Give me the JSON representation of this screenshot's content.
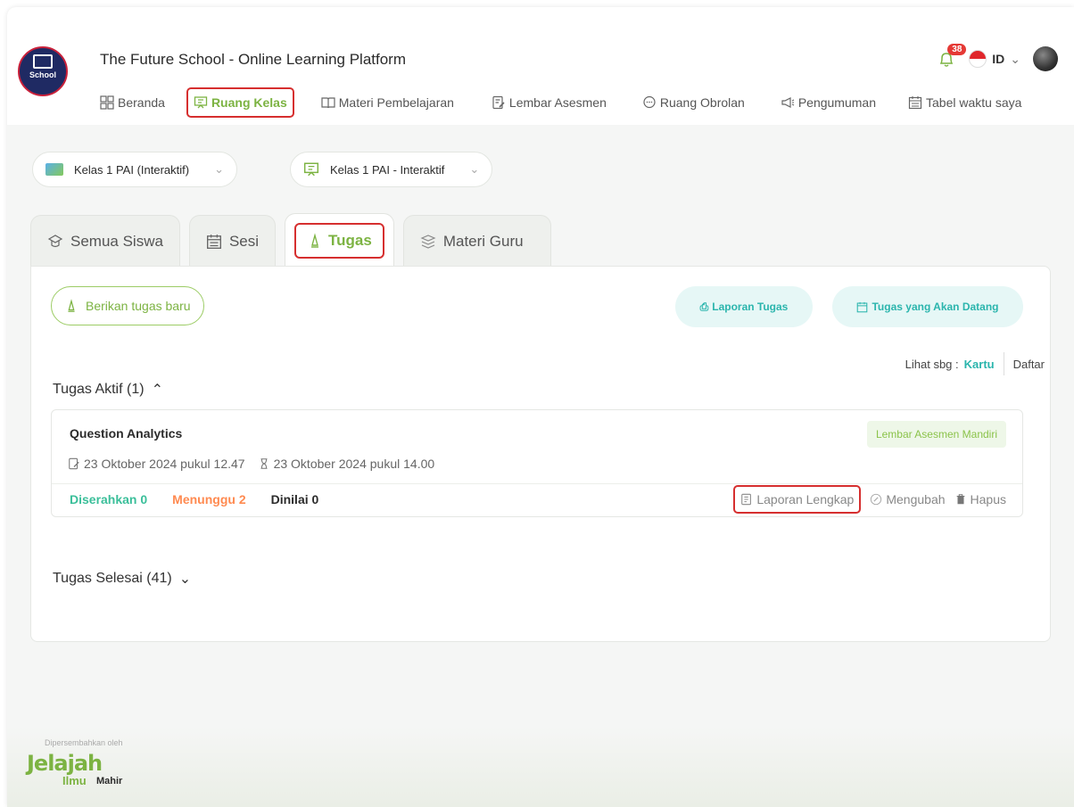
{
  "app": {
    "title": "The Future School - Online Learning Platform",
    "logo_text": "School",
    "notification_count": "38",
    "language": "ID"
  },
  "nav": {
    "items": [
      {
        "label": "Beranda",
        "icon": "grid-icon"
      },
      {
        "label": "Ruang Kelas",
        "icon": "classroom-icon",
        "active": true
      },
      {
        "label": "Materi Pembelajaran",
        "icon": "book-icon"
      },
      {
        "label": "Lembar Asesmen",
        "icon": "assessment-icon"
      },
      {
        "label": "Ruang Obrolan",
        "icon": "chat-icon"
      },
      {
        "label": "Pengumuman",
        "icon": "megaphone-icon"
      },
      {
        "label": "Tabel waktu saya",
        "icon": "calendar-icon"
      }
    ]
  },
  "selectors": {
    "class": "Kelas 1 PAI (Interaktif)",
    "room": "Kelas 1 PAI - Interaktif"
  },
  "tabs": [
    {
      "label": "Semua Siswa",
      "icon": "students-icon"
    },
    {
      "label": "Sesi",
      "icon": "calendar-icon"
    },
    {
      "label": "Tugas",
      "icon": "pen-icon",
      "active": true
    },
    {
      "label": "Materi Guru",
      "icon": "materials-icon"
    }
  ],
  "toolbar": {
    "new_assignment": "Berikan tugas baru",
    "report": "Laporan Tugas",
    "upcoming": "Tugas yang Akan Datang"
  },
  "view": {
    "prefix": "Lihat sbg :",
    "card": "Kartu",
    "list": "Daftar"
  },
  "sections": {
    "active": "Tugas Aktif (1)",
    "done": "Tugas Selesai (41)"
  },
  "assignment": {
    "title": "Question Analytics",
    "tag": "Lembar Asesmen Mandiri",
    "start": "23 Oktober 2024 pukul 12.47",
    "end": "23 Oktober 2024 pukul 14.00",
    "submitted": "Diserahkan 0",
    "waiting": "Menunggu 2",
    "graded": "Dinilai 0",
    "actions": {
      "report": "Laporan Lengkap",
      "edit": "Mengubah",
      "delete": "Hapus"
    }
  },
  "footer": {
    "presented_by": "Dipersembahkan oleh",
    "brand_top": "Jelajah",
    "brand_mid": "Ilmu",
    "brand_end": "Mahir"
  },
  "colors": {
    "accent_green": "#7cb342",
    "accent_teal": "#2bb5ad",
    "highlight_red": "#d62f2f",
    "waiting_orange": "#ff8a50"
  }
}
